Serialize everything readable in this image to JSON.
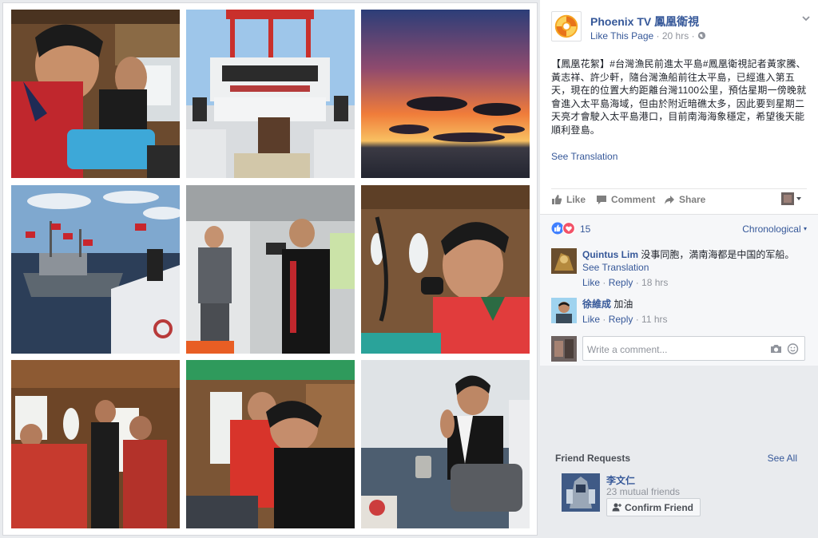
{
  "page": {
    "name": "Phoenix TV 鳳凰衛視",
    "like_label": "Like This Page",
    "time": "20 hrs",
    "separator": "·"
  },
  "post": {
    "text": "【鳳凰花絮】#台灣漁民前進太平島#鳳凰衛視記者黃家騰、黃志祥、許少軒，隨台灣漁船前往太平島，已經進入第五天，現在的位置大約距離台灣1100公里，預估星期一傍晚就會進入太平島海域，但由於附近暗礁太多，因此要到星期二天亮才會駛入太平島港口，目前南海海象穩定，希望後天能順利登島。",
    "see_translation": "See Translation"
  },
  "actions": {
    "like": "Like",
    "comment": "Comment",
    "share": "Share"
  },
  "reactions": {
    "count": "15",
    "sort": "Chronological"
  },
  "comments": [
    {
      "name": "Quintus Lim",
      "text": "没事同胞，満南海都是中国的军船。",
      "see_translation": "See Translation",
      "like": "Like",
      "reply": "Reply",
      "time": "18 hrs"
    },
    {
      "name": "徐維成",
      "text": "加油",
      "like": "Like",
      "reply": "Reply",
      "time": "11 hrs"
    }
  ],
  "composer": {
    "placeholder": "Write a comment..."
  },
  "friend_requests": {
    "title": "Friend Requests",
    "see_all": "See All",
    "name": "李文仁",
    "mutual": "23 mutual friends",
    "confirm": "Confirm Friend"
  },
  "colors": {
    "link": "#365899",
    "brand_orange": "#f08a24",
    "like_blue": "#4080ff",
    "love_red": "#f25268"
  },
  "icons": [
    "phoenix-logo-icon",
    "chevron-down-icon",
    "like-icon",
    "comment-icon",
    "share-icon",
    "camera-icon",
    "emoji-icon",
    "add-friend-icon"
  ]
}
